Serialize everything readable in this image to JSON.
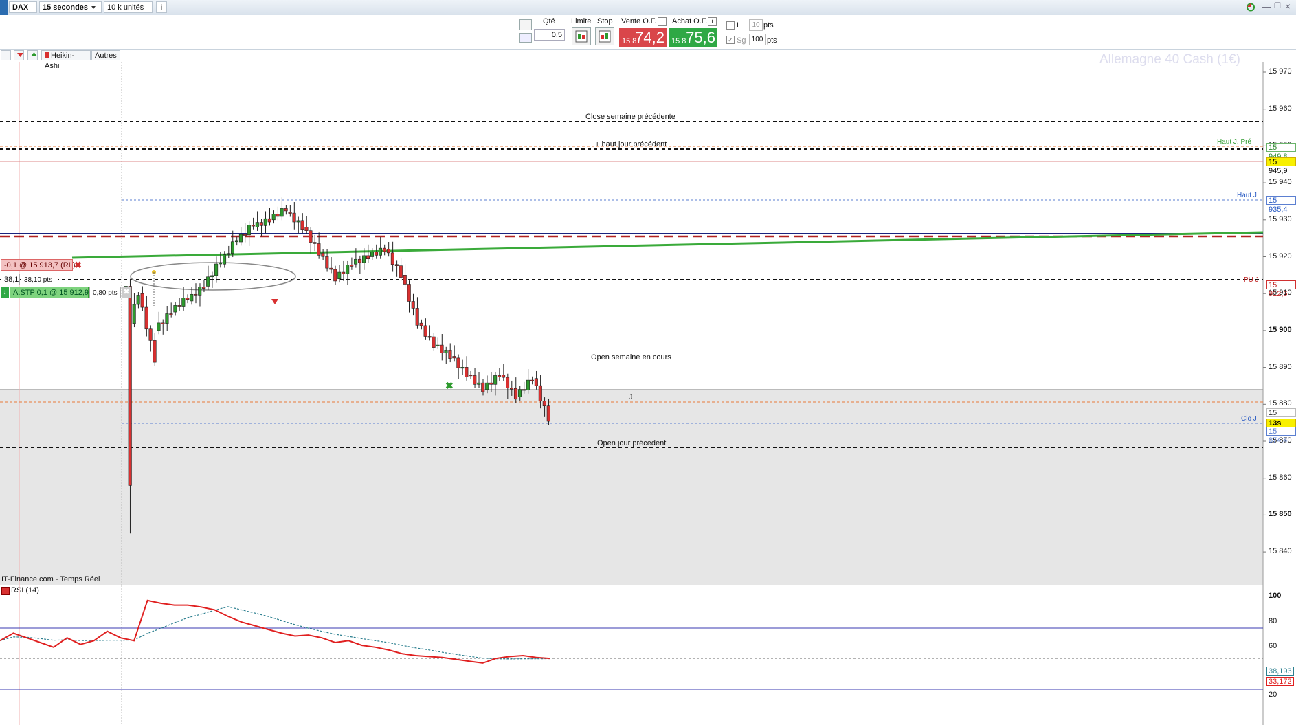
{
  "topbar": {
    "instrument": "DAX",
    "interval": "15 secondes",
    "volume": "10 k unités",
    "info_icon": "info-icon"
  },
  "trade": {
    "qty_label": "Qté",
    "qty_value": "0.5",
    "limit_label": "Limite",
    "stop_label": "Stop",
    "sell_label": "Vente O.F.",
    "buy_label": "Achat O.F.",
    "sell_prefix": "15 8",
    "sell_price": "74,2",
    "buy_prefix": "15 8",
    "buy_price": "75,6",
    "l_label": "L",
    "l_value": "10",
    "l_unit": "pts",
    "sg_label": "Sg",
    "sg_value": "100",
    "sg_unit": "pts"
  },
  "tools": {
    "heikin": "Heikin-Ashi",
    "autres": "Autres"
  },
  "chart": {
    "instrument_title": "Allemagne 40 Cash (1€)",
    "source": "IT-Finance.com - Temps Réel",
    "y_ticks": [
      "15 970",
      "15 960",
      "15 950",
      "15 940",
      "15 930",
      "15 920",
      "15 910",
      "15 900",
      "15 890",
      "15 880",
      "15 870",
      "15 860",
      "15 850",
      "15 840"
    ],
    "lines": {
      "close_semaine": "Close semaine précédente",
      "haut_jour_prec": "+ haut jour précédent",
      "open_semaine": "Open semaine en cours",
      "open_jour_prec": "Open jour précédent",
      "j_label": "J"
    },
    "right_labels": {
      "haut_j_pre": "Haut J. Pré",
      "haut_j": "Haut J",
      "pu_j": "PU J",
      "clo_j": "Clo J"
    },
    "tags": {
      "t15949": "15 949,8",
      "t15945": "15 945,9",
      "t15935": "15 935,4",
      "t15912": "15 912,6",
      "t15875": "15 875,0",
      "tlast": "13s 74,9",
      "t15874": "15 874,4"
    },
    "orders": {
      "rl": "-0,1 @ 15 913,7 (RL)",
      "rl_pts_a": "38,1",
      "rl_pts_b": "38,10 pts",
      "stp": "A:STP 0,1 @ 15 912,9",
      "stp_pts": "0,80 pts"
    },
    "colors": {
      "bull": "#2e9a2e",
      "bear": "#d83030",
      "trend": "#3aaa3a"
    }
  },
  "rsi": {
    "label": "RSI (14)",
    "ticks": [
      "100",
      "80",
      "60",
      "40",
      "20"
    ],
    "value_a": "38,193",
    "value_b": "33,172"
  },
  "chart_data": {
    "type": "line",
    "y_axis_range": [
      15835,
      15975
    ],
    "candles_ohlc_approx": [
      [
        15895,
        15912,
        15838,
        15910
      ],
      [
        15910,
        15916,
        15888,
        15892
      ],
      [
        15900,
        15908,
        15896,
        15905
      ],
      [
        15905,
        15912,
        15902,
        15909
      ],
      [
        15908,
        15915,
        15906,
        15912
      ],
      [
        15912,
        15922,
        15910,
        15919
      ],
      [
        15918,
        15928,
        15915,
        15925
      ],
      [
        15924,
        15931,
        15919,
        15929
      ],
      [
        15928,
        15934,
        15925,
        15930
      ],
      [
        15930,
        15936,
        15927,
        15933
      ],
      [
        15932,
        15935,
        15925,
        15928
      ],
      [
        15928,
        15931,
        15918,
        15921
      ],
      [
        15921,
        15925,
        15911,
        15914
      ],
      [
        15914,
        15920,
        15910,
        15918
      ],
      [
        15918,
        15923,
        15914,
        15920
      ],
      [
        15920,
        15926,
        15916,
        15922
      ],
      [
        15922,
        15924,
        15912,
        15915
      ],
      [
        15915,
        15920,
        15898,
        15902
      ],
      [
        15902,
        15906,
        15893,
        15896
      ],
      [
        15896,
        15901,
        15890,
        15893
      ],
      [
        15893,
        15897,
        15886,
        15888
      ],
      [
        15888,
        15893,
        15880,
        15884
      ],
      [
        15884,
        15891,
        15880,
        15888
      ],
      [
        15888,
        15892,
        15879,
        15882
      ],
      [
        15882,
        15891,
        15880,
        15887
      ],
      [
        15887,
        15890,
        15874,
        15876
      ]
    ],
    "levels": {
      "close_semaine_precedente": 15956.5,
      "haut_jour_precedent": 15949.8,
      "current_line": 15945.9,
      "haut_j": 15935.4,
      "pu_j": 15912.6,
      "open_semaine_en_cours": 15891.5,
      "j": 15884,
      "clo_j": 15874.4,
      "open_jour_precedent": 15869.5
    },
    "rsi_series": [
      52,
      60,
      55,
      50,
      45,
      55,
      48,
      52,
      62,
      55,
      52,
      95,
      92,
      90,
      90,
      88,
      85,
      78,
      72,
      68,
      64,
      60,
      57,
      58,
      55,
      50,
      52,
      47,
      45,
      42,
      38,
      36,
      35,
      34,
      32,
      30,
      28,
      33,
      35,
      36,
      34,
      33
    ]
  }
}
